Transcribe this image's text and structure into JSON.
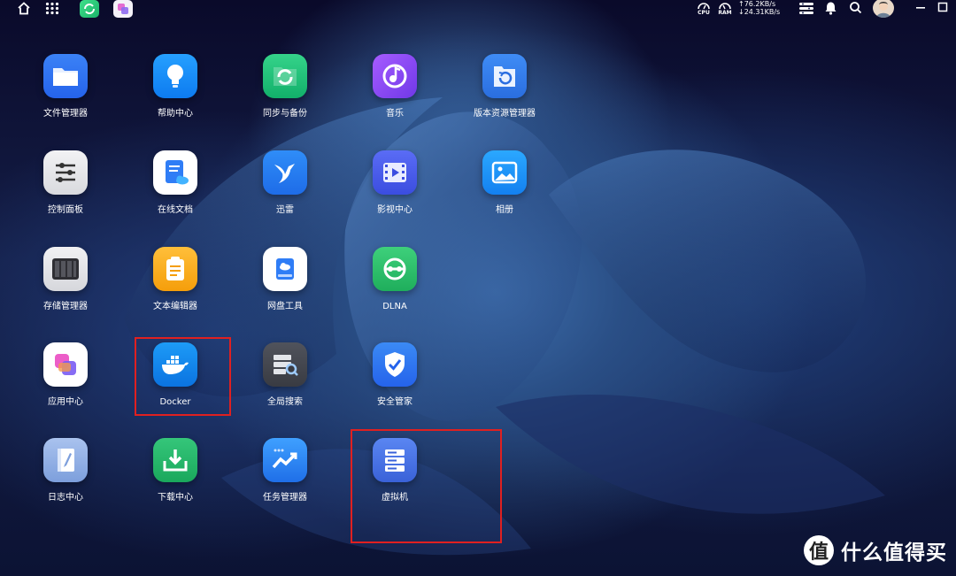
{
  "topbar": {
    "cpu_label": "CPU",
    "ram_label": "RAM",
    "upload": "↑76.2KB/s",
    "download": "↓24.31KB/s"
  },
  "apps": [
    {
      "label": "文件管理器",
      "icon": "folder-icon"
    },
    {
      "label": "帮助中心",
      "icon": "lightbulb-icon"
    },
    {
      "label": "同步与备份",
      "icon": "sync-folder-icon"
    },
    {
      "label": "音乐",
      "icon": "music-icon"
    },
    {
      "label": "版本资源管理器",
      "icon": "version-restore-icon"
    },
    {
      "label": "控制面板",
      "icon": "sliders-icon"
    },
    {
      "label": "在线文档",
      "icon": "cloud-document-icon"
    },
    {
      "label": "迅雷",
      "icon": "thunder-bird-icon"
    },
    {
      "label": "影视中心",
      "icon": "video-icon"
    },
    {
      "label": "相册",
      "icon": "photo-icon"
    },
    {
      "label": "存储管理器",
      "icon": "storage-bays-icon"
    },
    {
      "label": "文本编辑器",
      "icon": "notepad-icon"
    },
    {
      "label": "网盘工具",
      "icon": "cloud-drive-icon"
    },
    {
      "label": "DLNA",
      "icon": "dlna-icon"
    },
    {
      "label": "应用中心",
      "icon": "app-center-icon"
    },
    {
      "label": "Docker",
      "icon": "docker-icon"
    },
    {
      "label": "全局搜索",
      "icon": "server-search-icon"
    },
    {
      "label": "安全管家",
      "icon": "shield-check-icon"
    },
    {
      "label": "日志中心",
      "icon": "log-book-icon"
    },
    {
      "label": "下载中心",
      "icon": "download-icon"
    },
    {
      "label": "任务管理器",
      "icon": "trend-chart-icon"
    },
    {
      "label": "虚拟机",
      "icon": "virtual-machine-icon"
    }
  ],
  "watermark": {
    "logo_glyph": "值",
    "text": "什么值得买"
  },
  "colors": {
    "highlight": "#e02020"
  }
}
